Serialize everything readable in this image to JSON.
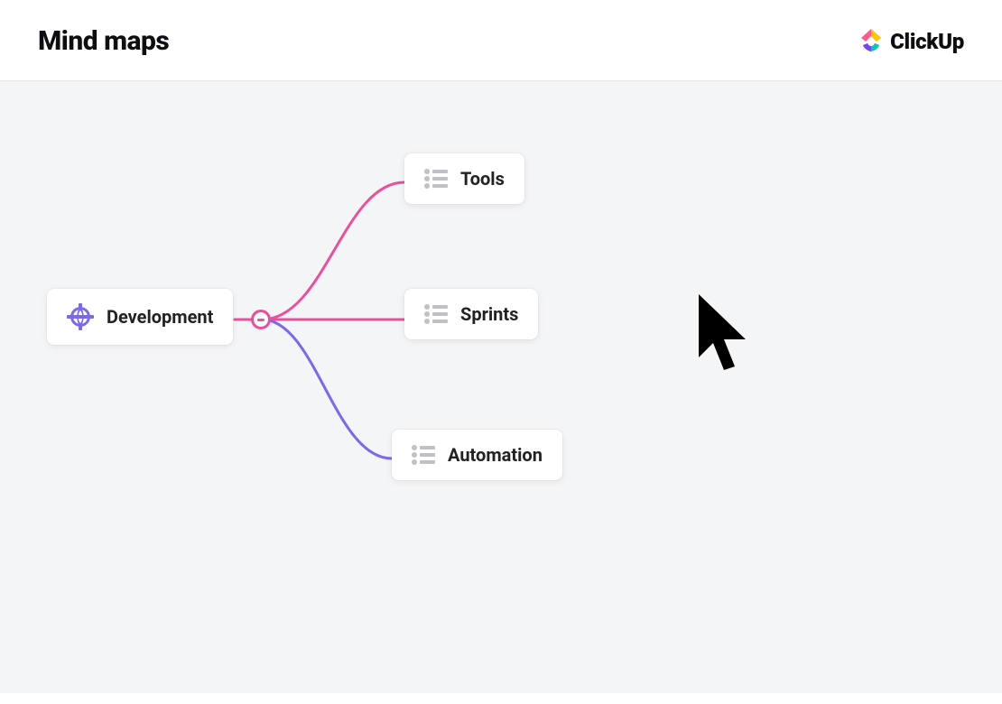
{
  "header": {
    "title": "Mind maps",
    "brand": "ClickUp"
  },
  "mindmap": {
    "root": {
      "label": "Development",
      "icon": "globe-icon"
    },
    "children": [
      {
        "label": "Tools",
        "icon": "list-icon",
        "connector_color": "#ec4f9a"
      },
      {
        "label": "Sprints",
        "icon": "list-icon",
        "connector_color": "#ec4f9a"
      },
      {
        "label": "Automation",
        "icon": "list-icon",
        "connector_color": "#7b68ee"
      }
    ],
    "collapse_symbol": "−"
  }
}
